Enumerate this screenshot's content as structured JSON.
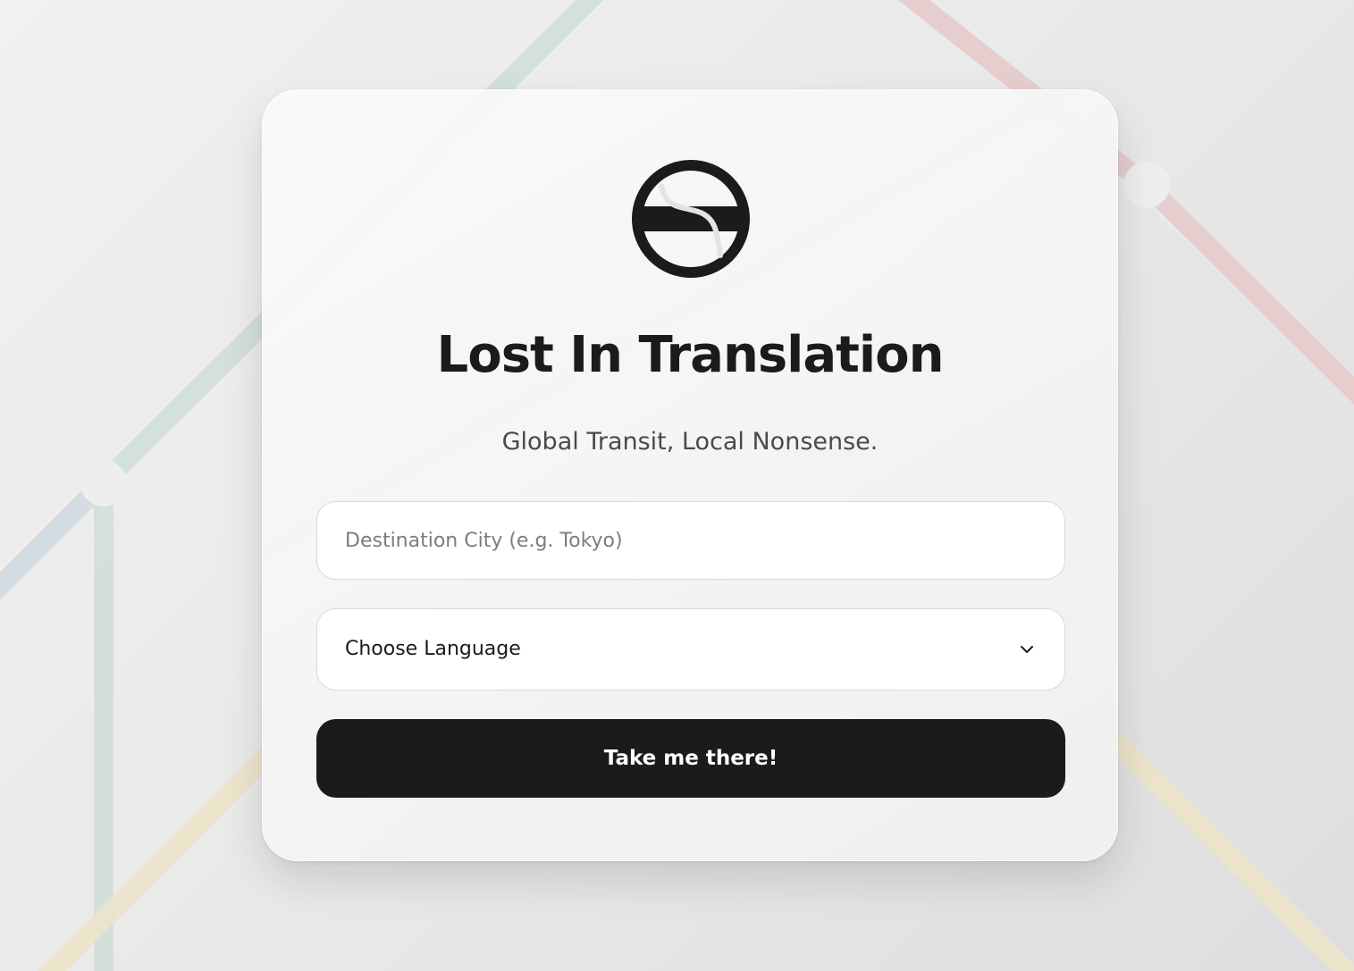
{
  "app": {
    "title": "Lost In Translation",
    "tagline": "Global Transit, Local Nonsense."
  },
  "logo": {
    "icon": "transit-roundel-icon",
    "color": "#1b1b1b"
  },
  "form": {
    "destination": {
      "value": "",
      "placeholder": "Destination City (e.g. Tokyo)"
    },
    "language": {
      "selected": "Choose Language",
      "icon": "chevron-down-icon"
    },
    "submit_label": "Take me there!"
  },
  "theme": {
    "primary": "#1b1b1b",
    "background": "#ececec",
    "card": "#f5f5f5",
    "line_colors": {
      "green": "#cddcd5",
      "red": "#e8c9c9",
      "yellow": "#ece3c6",
      "blue": "#cfd9e3"
    }
  }
}
